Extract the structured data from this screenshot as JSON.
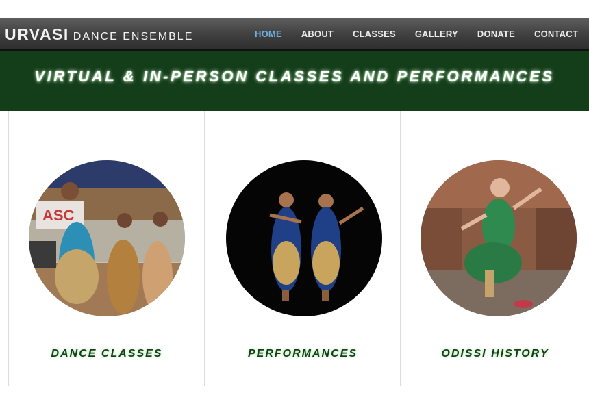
{
  "brand": {
    "name": "URVASI",
    "tagline": "DANCE ENSEMBLE"
  },
  "nav": {
    "items": [
      {
        "label": "HOME",
        "active": true
      },
      {
        "label": "ABOUT"
      },
      {
        "label": "CLASSES"
      },
      {
        "label": "GALLERY"
      },
      {
        "label": "DONATE"
      },
      {
        "label": "CONTACT"
      }
    ]
  },
  "banner": {
    "title": "VIRTUAL & IN-PERSON CLASSES AND PERFORMANCES"
  },
  "sections": [
    {
      "title": "DANCE CLASSES"
    },
    {
      "title": "PERFORMANCES"
    },
    {
      "title": "ODISSI HISTORY"
    }
  ],
  "colors": {
    "header_bg": "#4a4a4a",
    "nav_active": "#6fb0e0",
    "banner_bg": "#143d19",
    "heading_green": "#143d19"
  }
}
